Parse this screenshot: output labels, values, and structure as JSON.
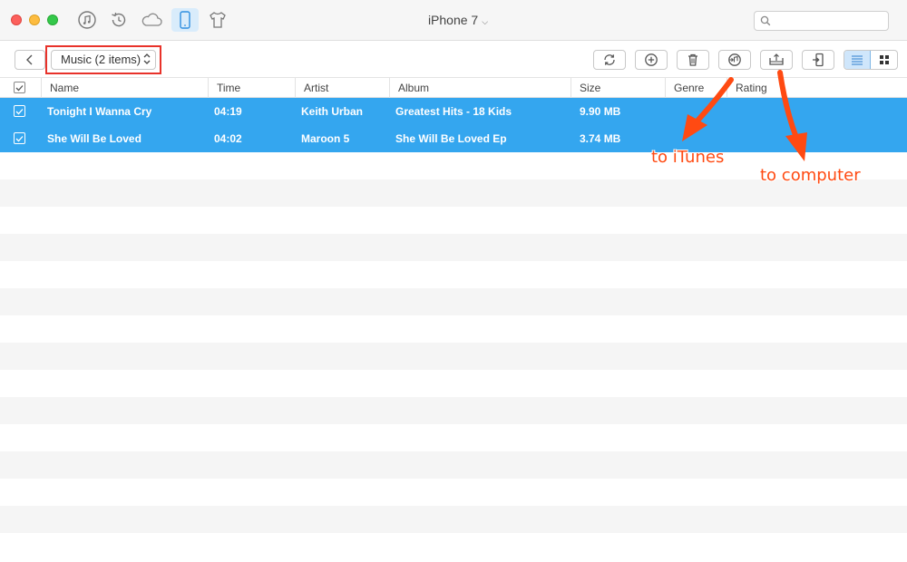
{
  "window": {
    "device_title": "iPhone 7",
    "nav_icons": [
      "music-library-icon",
      "restore-icon",
      "icloud-icon",
      "iphone-icon",
      "shirt-icon"
    ],
    "search_placeholder": ""
  },
  "toolbar": {
    "category_select": "Music (2 items)",
    "buttons": [
      "refresh-icon",
      "add-icon",
      "delete-icon",
      "to-itunes-icon",
      "to-computer-icon",
      "to-device-icon"
    ],
    "view_modes": [
      "list-view-icon",
      "grid-view-icon"
    ],
    "active_view": "list"
  },
  "table": {
    "columns": [
      "Name",
      "Time",
      "Artist",
      "Album",
      "Size",
      "Genre",
      "Rating"
    ],
    "rows": [
      {
        "checked": true,
        "name": "Tonight I Wanna Cry",
        "time": "04:19",
        "artist": "Keith Urban",
        "album": "Greatest Hits - 18 Kids",
        "size": "9.90 MB",
        "genre": "",
        "rating": ""
      },
      {
        "checked": true,
        "name": "She Will Be Loved",
        "time": "04:02",
        "artist": "Maroon 5",
        "album": "She Will Be Loved Ep",
        "size": "3.74 MB",
        "genre": "",
        "rating": ""
      }
    ]
  },
  "annotations": {
    "itunes_label": "to iTunes",
    "computer_label": "to computer",
    "highlight_color": "#e8322a",
    "arrow_color": "#ff4a12"
  },
  "colors": {
    "selection": "#34a6ef",
    "stripe": "#f5f5f5"
  }
}
